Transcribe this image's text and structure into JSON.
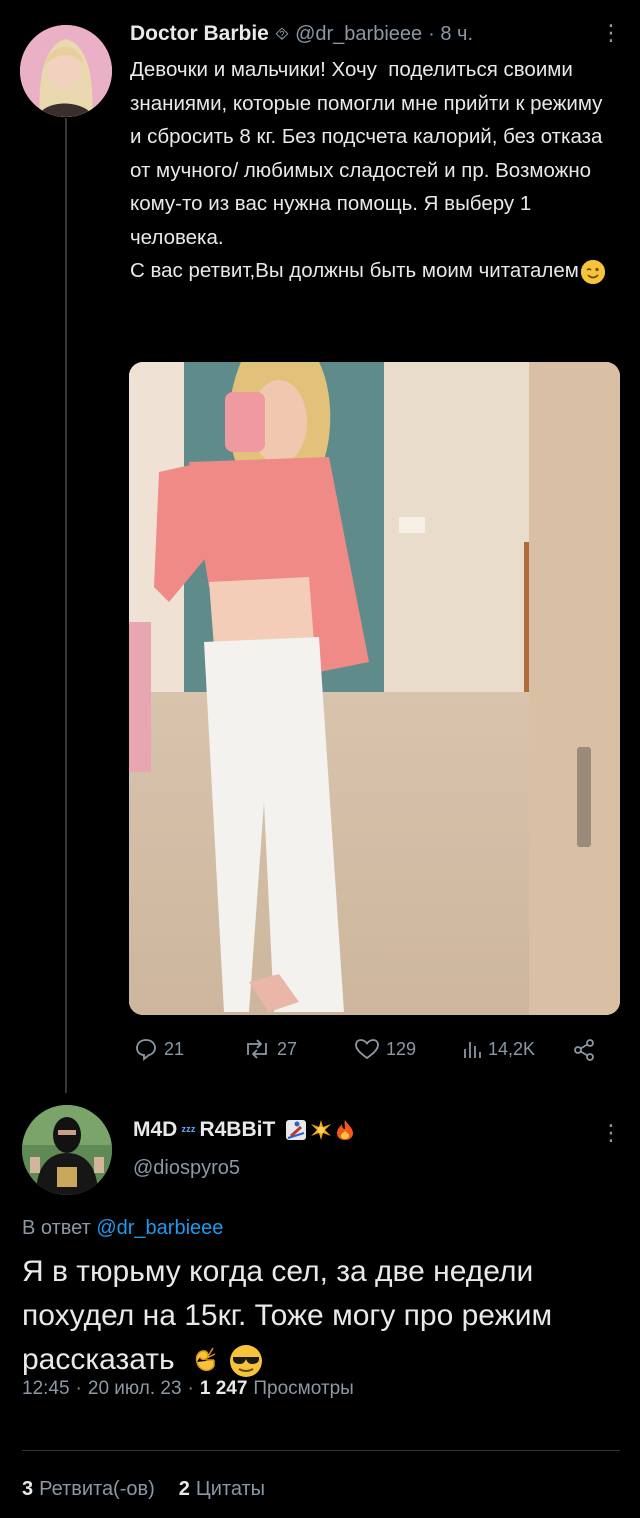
{
  "tweet": {
    "author_name": "Doctor Barbie",
    "badge_glyph": "⯑",
    "handle": "@dr_barbieee",
    "time": "· 8 ч.",
    "text": "Девочки и мальчики! Хочу  поделиться своими знаниями, которые помогли мне прийти к режиму и сбросить 8 кг. Без подсчета калорий, без отказа от мучного/ любимых сладостей и пр. Возможно кому-то из вас нужна помощь. Я выберу 1 человека.\nС вас ретвит,Вы должны быть моим читаталем",
    "actions": {
      "replies": "21",
      "retweets": "27",
      "likes": "129",
      "views": "14,2K"
    }
  },
  "reply": {
    "author_name": "M4D",
    "author_name_suffix": "R4BBiT",
    "handle": "@diospyro5",
    "in_reply_prefix": "В ответ",
    "in_reply_handle": "@dr_barbieee",
    "text": "Я в тюрьму когда сел, за две недели похудел на 15кг. Тоже могу про режим рассказать",
    "time": "12:45",
    "date": "20 июл. 23",
    "views_count": "1 247",
    "views_label": "Просмотры",
    "stats": {
      "retweets_count": "3",
      "retweets_label": "Ретвита(-ов)",
      "quotes_count": "2",
      "quotes_label": "Цитаты"
    }
  },
  "colors": {
    "background": "#000000",
    "text": "#e7e9ea",
    "muted": "#8b98a5",
    "link": "#1d9bf0",
    "divider": "#2f3336"
  }
}
